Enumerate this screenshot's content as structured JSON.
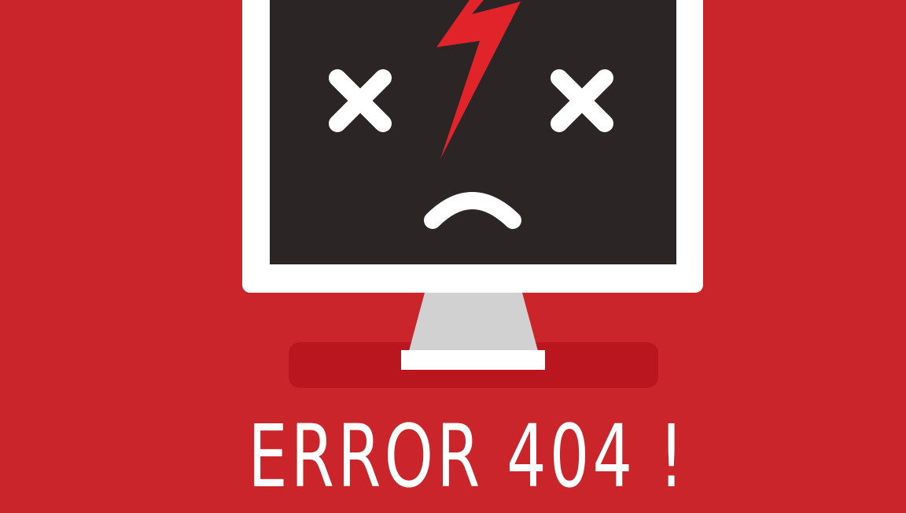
{
  "page": {
    "background_color": "#c9252a"
  },
  "illustration": {
    "bezel_color": "#ffffff",
    "screen_color": "#2b2526",
    "stand_color": "#d1d1d1",
    "base_color": "#b9161f",
    "bolt_color": "#e12429",
    "face_color": "#ffffff",
    "icons": [
      "monitor-icon",
      "lightning-bolt-icon",
      "x-eye-icon",
      "sad-mouth-icon"
    ]
  },
  "message": {
    "text": "ERROR 404 !",
    "color": "#ffffff"
  }
}
